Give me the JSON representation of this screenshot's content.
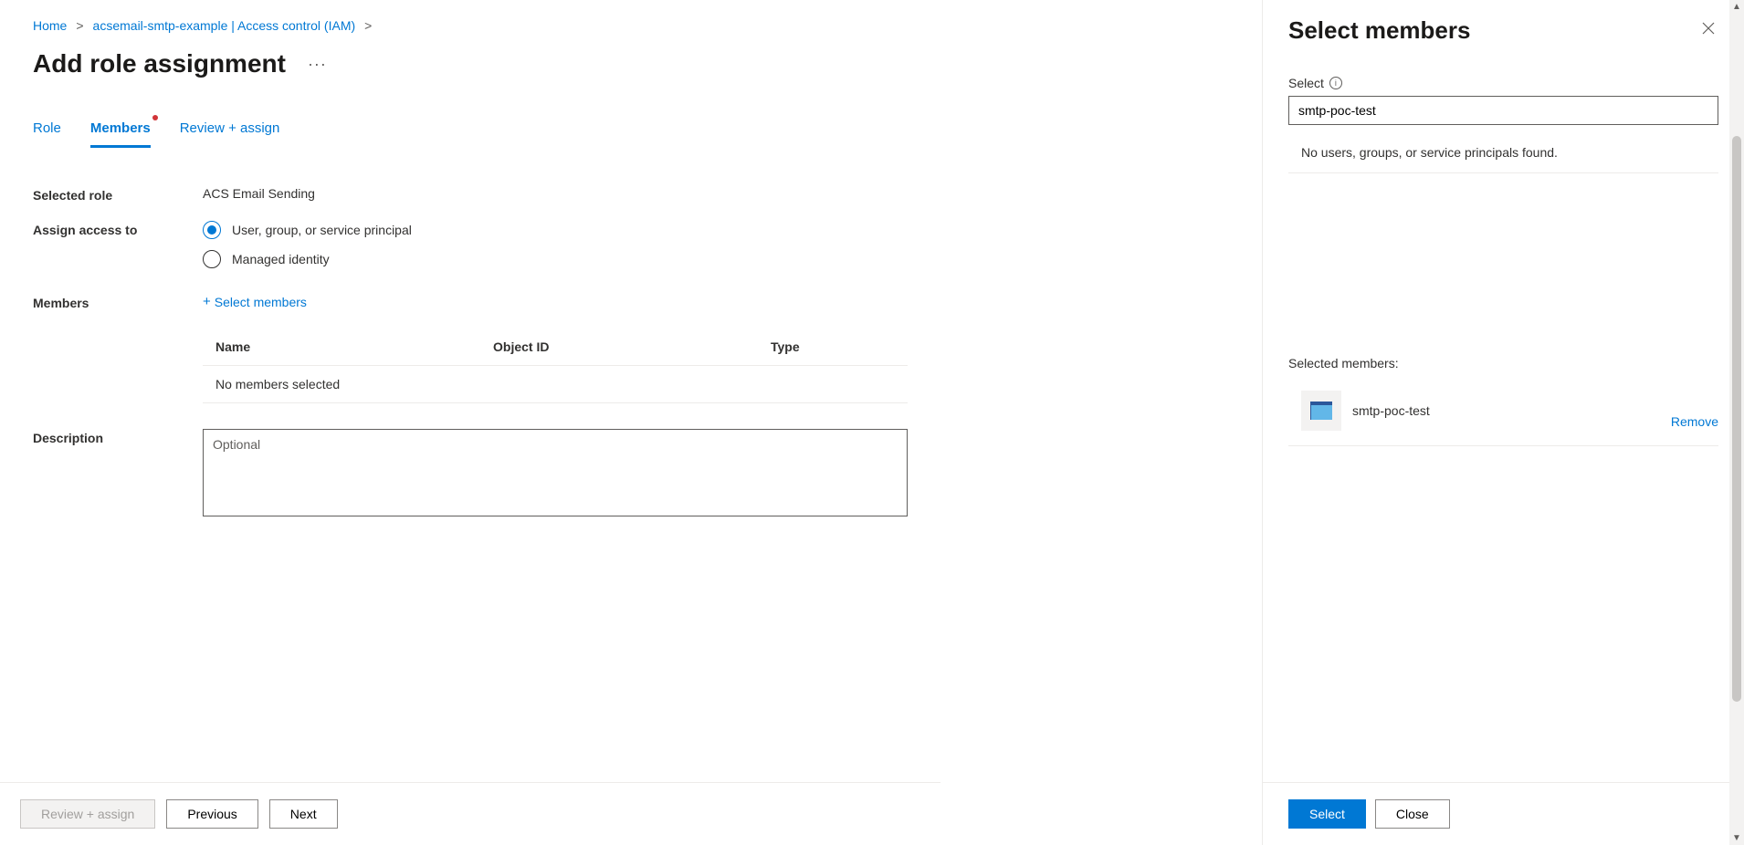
{
  "breadcrumb": {
    "home": "Home",
    "resource": "acsemail-smtp-example | Access control (IAM)"
  },
  "page": {
    "title": "Add role assignment"
  },
  "tabs": {
    "role": "Role",
    "members": "Members",
    "review": "Review + assign"
  },
  "form": {
    "selected_role_label": "Selected role",
    "selected_role_value": "ACS Email Sending",
    "assign_access_label": "Assign access to",
    "radio_user_group": "User, group, or service principal",
    "radio_managed_identity": "Managed identity",
    "members_label": "Members",
    "select_members_link": "Select members",
    "description_label": "Description",
    "description_placeholder": "Optional"
  },
  "members_table": {
    "col_name": "Name",
    "col_object": "Object ID",
    "col_type": "Type",
    "empty": "No members selected"
  },
  "footer": {
    "review_assign": "Review + assign",
    "previous": "Previous",
    "next": "Next"
  },
  "panel": {
    "title": "Select members",
    "select_label": "Select",
    "search_value": "smtp-poc-test",
    "no_results": "No users, groups, or service principals found.",
    "selected_label": "Selected members:",
    "selected_member_name": "smtp-poc-test",
    "remove": "Remove",
    "select_btn": "Select",
    "close_btn": "Close"
  }
}
